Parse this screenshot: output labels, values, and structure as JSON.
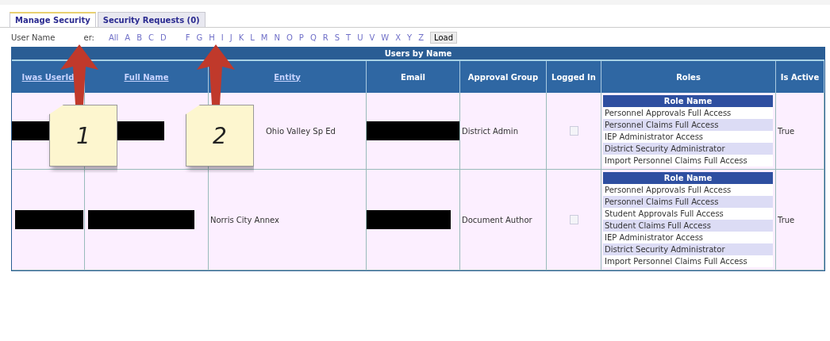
{
  "tabs": [
    {
      "label": "Manage Security",
      "selected": true
    },
    {
      "label": "Security Requests (0)",
      "selected": false
    }
  ],
  "filter": {
    "label_parts": [
      "User Name",
      "er:"
    ],
    "letters": [
      "All",
      "A",
      "B",
      "C",
      "D",
      "F",
      "G",
      "H",
      "I",
      "J",
      "K",
      "L",
      "M",
      "N",
      "O",
      "P",
      "Q",
      "R",
      "S",
      "T",
      "U",
      "V",
      "W",
      "X",
      "Y",
      "Z"
    ],
    "load_button": "Load"
  },
  "table": {
    "title": "Users by Name",
    "columns": [
      {
        "label": "Iwas UserId",
        "link": true
      },
      {
        "label": "Full Name",
        "link": true
      },
      {
        "label": "Entity",
        "link": true
      },
      {
        "label": "Email",
        "link": false
      },
      {
        "label": "Approval Group",
        "link": false
      },
      {
        "label": "Logged In",
        "link": false
      },
      {
        "label": "Roles",
        "link": false
      },
      {
        "label": "Is Active",
        "link": false
      }
    ],
    "rows": [
      {
        "entity": "Ohio Valley Sp Ed",
        "approval_group": "District Admin",
        "logged_in": false,
        "roles_header": "Role Name",
        "roles": [
          "Personnel Approvals Full Access",
          "Personnel Claims Full Access",
          "IEP Administrator Access",
          "District Security Administrator",
          "Import Personnel Claims Full Access"
        ],
        "is_active": "True"
      },
      {
        "entity": "Norris City Annex",
        "approval_group": "Document Author",
        "logged_in": false,
        "roles_header": "Role Name",
        "roles": [
          "Personnel Approvals Full Access",
          "Personnel Claims Full Access",
          "Student Approvals Full Access",
          "Student Claims Full Access",
          "IEP Administrator Access",
          "District Security Administrator",
          "Import Personnel Claims Full Access"
        ],
        "is_active": "True"
      }
    ]
  },
  "annotations": [
    {
      "label": "1"
    },
    {
      "label": "2"
    }
  ]
}
